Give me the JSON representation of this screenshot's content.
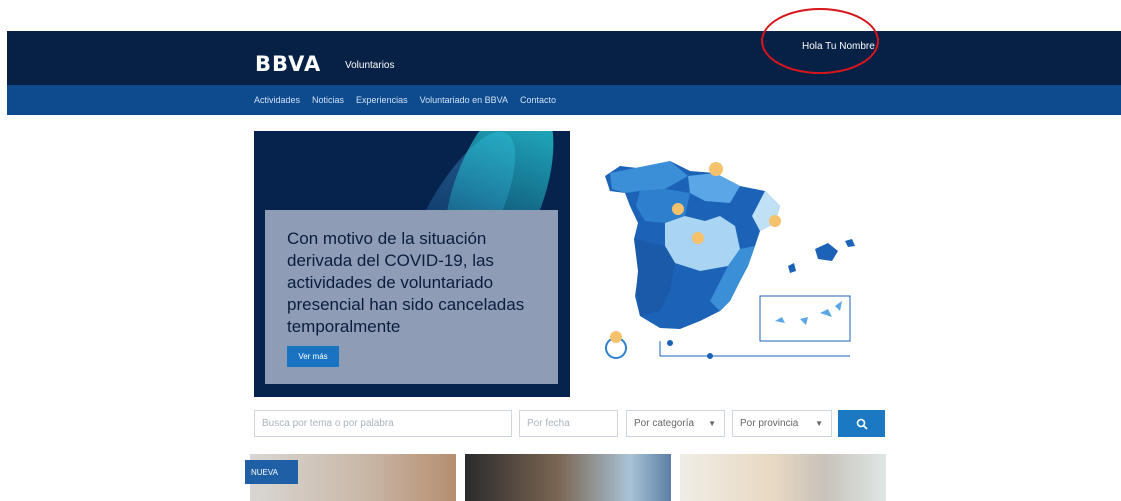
{
  "header": {
    "logo": "BBVA",
    "subtitle": "Voluntarios",
    "greeting": "Hola Tu Nombre"
  },
  "nav": {
    "items": [
      "Actividades",
      "Noticias",
      "Experiencias",
      "Voluntariado en BBVA",
      "Contacto"
    ]
  },
  "hero": {
    "message": "Con motivo de la situación derivada del COVID-19, las actividades de voluntariado presencial han sido canceladas temporalmente",
    "button_label": "Ver más",
    "map_icon": "spain-map-icon"
  },
  "search": {
    "keyword_placeholder": "Busca por tema o por palabra",
    "date_placeholder": "Por fecha",
    "category_value": "Por categoría",
    "province_value": "Por provincia",
    "search_icon": "search-icon"
  },
  "cards": {
    "badge": "NUEVA"
  },
  "colors": {
    "header_bg": "#072146",
    "nav_bg": "#0d4b8e",
    "accent": "#1b78c2",
    "highlight_circle": "#d8151b"
  }
}
